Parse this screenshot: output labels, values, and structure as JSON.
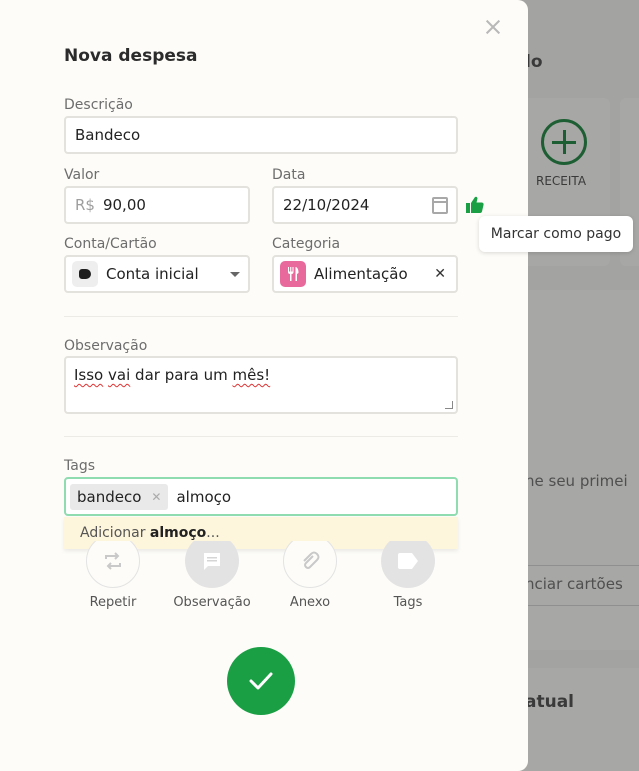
{
  "background": {
    "title_fragment": "lo",
    "card_label": "RECEITA",
    "line1": "ne seu primei",
    "line2": "nciar cartões",
    "line3": "atual"
  },
  "modal": {
    "title": "Nova despesa",
    "descricao": {
      "label": "Descrição",
      "value": "Bandeco"
    },
    "valor": {
      "label": "Valor",
      "prefix": "R$",
      "value": "90,00"
    },
    "data": {
      "label": "Data",
      "value": "22/10/2024"
    },
    "tooltip": "Marcar como pago",
    "conta": {
      "label": "Conta/Cartão",
      "value": "Conta inicial"
    },
    "categoria": {
      "label": "Categoria",
      "value": "Alimentação",
      "color": "#e86a9c"
    },
    "observacao": {
      "label": "Observação",
      "words": [
        "Isso",
        "vai",
        "dar",
        "para",
        "um",
        "mês!"
      ]
    },
    "tags": {
      "label": "Tags",
      "chips": [
        "bandeco"
      ],
      "input_value": "almoço",
      "suggestion_prefix": "Adicionar",
      "suggestion_value": "almoço",
      "suggestion_suffix": "..."
    },
    "actions": [
      {
        "label": "Repetir",
        "icon": "repeat-icon"
      },
      {
        "label": "Observação",
        "icon": "note-icon"
      },
      {
        "label": "Anexo",
        "icon": "paperclip-icon"
      },
      {
        "label": "Tags",
        "icon": "tag-icon"
      }
    ],
    "confirm_color": "#1a9f45"
  }
}
